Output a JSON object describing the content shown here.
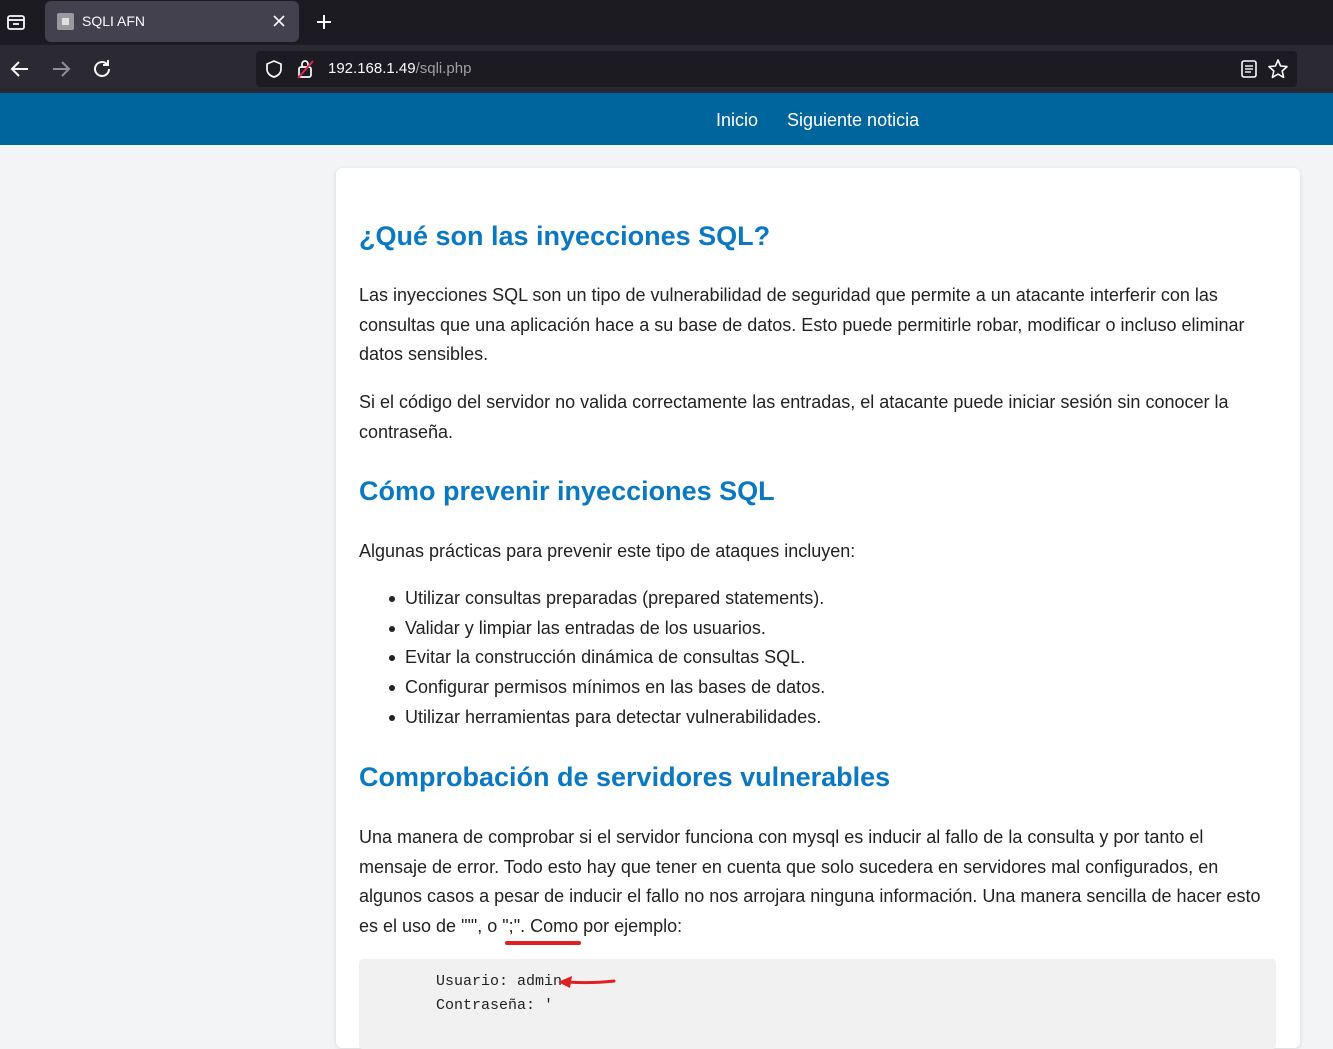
{
  "browser": {
    "tab_title": "SQLI AFN",
    "url_host": "192.168.1.49",
    "url_path": "/sqli.php"
  },
  "site_nav": {
    "inicio": "Inicio",
    "siguiente": "Siguiente noticia"
  },
  "article": {
    "h1": "¿Qué son las inyecciones SQL?",
    "p1": "Las inyecciones SQL son un tipo de vulnerabilidad de seguridad que permite a un atacante interferir con las consultas que una aplicación hace a su base de datos. Esto puede permitirle robar, modificar o incluso eliminar datos sensibles.",
    "p2": "Si el código del servidor no valida correctamente las entradas, el atacante puede iniciar sesión sin conocer la contraseña.",
    "h2": "Cómo prevenir inyecciones SQL",
    "p3": "Algunas prácticas para prevenir este tipo de ataques incluyen:",
    "practices": [
      "Utilizar consultas preparadas (prepared statements).",
      "Validar y limpiar las entradas de los usuarios.",
      "Evitar la construcción dinámica de consultas SQL.",
      "Configurar permisos mínimos en las bases de datos.",
      "Utilizar herramientas para detectar vulnerabilidades."
    ],
    "h3": "Comprobación de servidores vulnerables",
    "p4": "Una manera de comprobar si el servidor funciona con mysql es inducir al fallo de la consulta y por tanto el mensaje de error. Todo esto hay que tener en cuenta que solo sucedera en servidores mal configurados, en algunos casos a pesar de inducir el fallo no nos arrojara ninguna información. Una manera sencilla de hacer esto es el uso de \"'\", o \";\". Como por ejemplo:",
    "code_line1": "Usuario: admin",
    "code_line2": "Contraseña: '"
  },
  "colors": {
    "header_bg": "#00649d",
    "heading": "#0a78c2",
    "annotation": "#e02020"
  }
}
